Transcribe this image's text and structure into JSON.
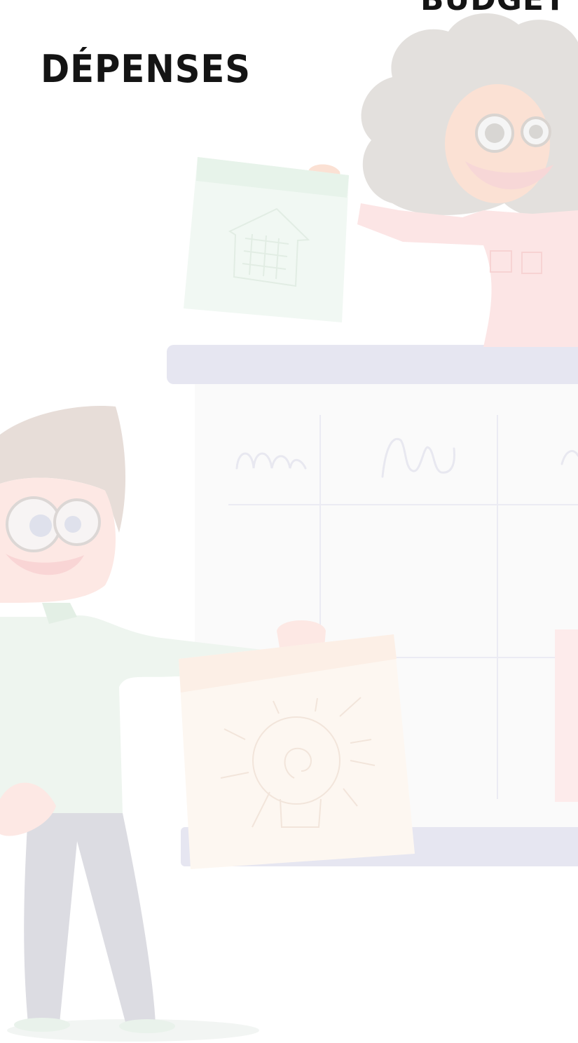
{
  "page": {
    "title": "DÉPENSES",
    "top_heading_fragment": "BUDGET R"
  },
  "colors": {
    "title_text": "#141414",
    "background": "#ffffff",
    "board_bar": "#e6e6f1",
    "board_panel": "#fafafa",
    "sticky_note_green": "#edf6ef",
    "sticky_note_cream": "#fdf7f1",
    "pink_jacket": "#fce5e5",
    "green_shirt": "#eef5ef",
    "gray_pants": "#dcdce2",
    "hair_gray": "#e3e0dd",
    "skin_tone": "#fbe1d4"
  },
  "icons": [
    "house-sketch-icon",
    "lightbulb-sketch-icon"
  ]
}
